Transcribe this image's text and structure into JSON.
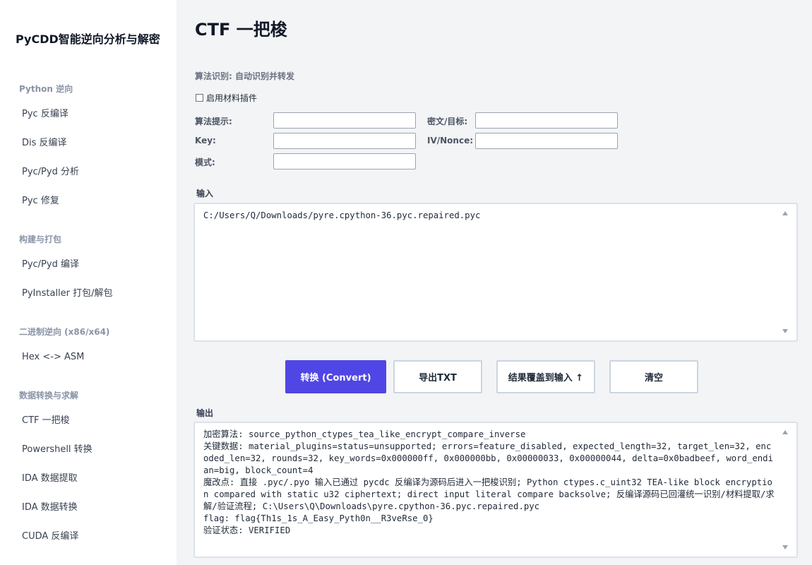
{
  "app": {
    "title": "PyCDD智能逆向分析与解密"
  },
  "sidebar": {
    "groups": [
      {
        "label": "Python 逆向",
        "items": [
          "Pyc 反编译",
          "Dis 反编译",
          "Pyc/Pyd 分析",
          "Pyc 修复"
        ]
      },
      {
        "label": "构建与打包",
        "items": [
          "Pyc/Pyd 编译",
          "PyInstaller 打包/解包"
        ]
      },
      {
        "label": "二进制逆向 (x86/x64)",
        "items": [
          "Hex <-> ASM"
        ]
      },
      {
        "label": "数据转换与求解",
        "items": [
          "CTF 一把梭",
          "Powershell 转换",
          "IDA 数据提取",
          "IDA 数据转换",
          "CUDA 反编译"
        ]
      }
    ]
  },
  "main": {
    "title": "CTF 一把梭",
    "algo_detect": "算法识别: 自动识别并转发",
    "plugin_checkbox": {
      "label": "启用材料插件",
      "checked": false
    },
    "fields": {
      "algo_hint": {
        "label": "算法提示:",
        "value": ""
      },
      "cipher": {
        "label": "密文/目标:",
        "value": ""
      },
      "key": {
        "label": "Key:",
        "value": ""
      },
      "iv": {
        "label": "IV/Nonce:",
        "value": ""
      },
      "mode": {
        "label": "模式:",
        "value": ""
      }
    },
    "input": {
      "label": "输入",
      "value": "C:/Users/Q/Downloads/pyre.cpython-36.pyc.repaired.pyc"
    },
    "buttons": {
      "convert": "转换 (Convert)",
      "export": "导出TXT",
      "overwrite": "结果覆盖到输入 ↑",
      "clear": "清空"
    },
    "output": {
      "label": "输出",
      "value": "加密算法: source_python_ctypes_tea_like_encrypt_compare_inverse\n关键数据: material_plugins=status=unsupported; errors=feature_disabled, expected_length=32, target_len=32, encoded_len=32, rounds=32, key_words=0x000000ff, 0x000000bb, 0x00000033, 0x00000044, delta=0x0badbeef, word_endian=big, block_count=4\n魔改点: 直接 .pyc/.pyo 输入已通过 pycdc 反编译为源码后进入一把梭识别; Python ctypes.c_uint32 TEA-like block encryption compared with static u32 ciphertext; direct input literal compare backsolve; 反编译源码已回灌统一识别/材料提取/求解/验证流程; C:\\Users\\Q\\Downloads\\pyre.cpython-36.pyc.repaired.pyc\nflag: flag{Th1s_1s_A_Easy_Pyth0n__R3veRse_0}\n验证状态: VERIFIED"
    }
  },
  "colors": {
    "accent": "#4f46e5",
    "sidebar_bg": "#ffffff",
    "main_bg": "#f3f4f6",
    "group_label": "#8a94a6"
  }
}
